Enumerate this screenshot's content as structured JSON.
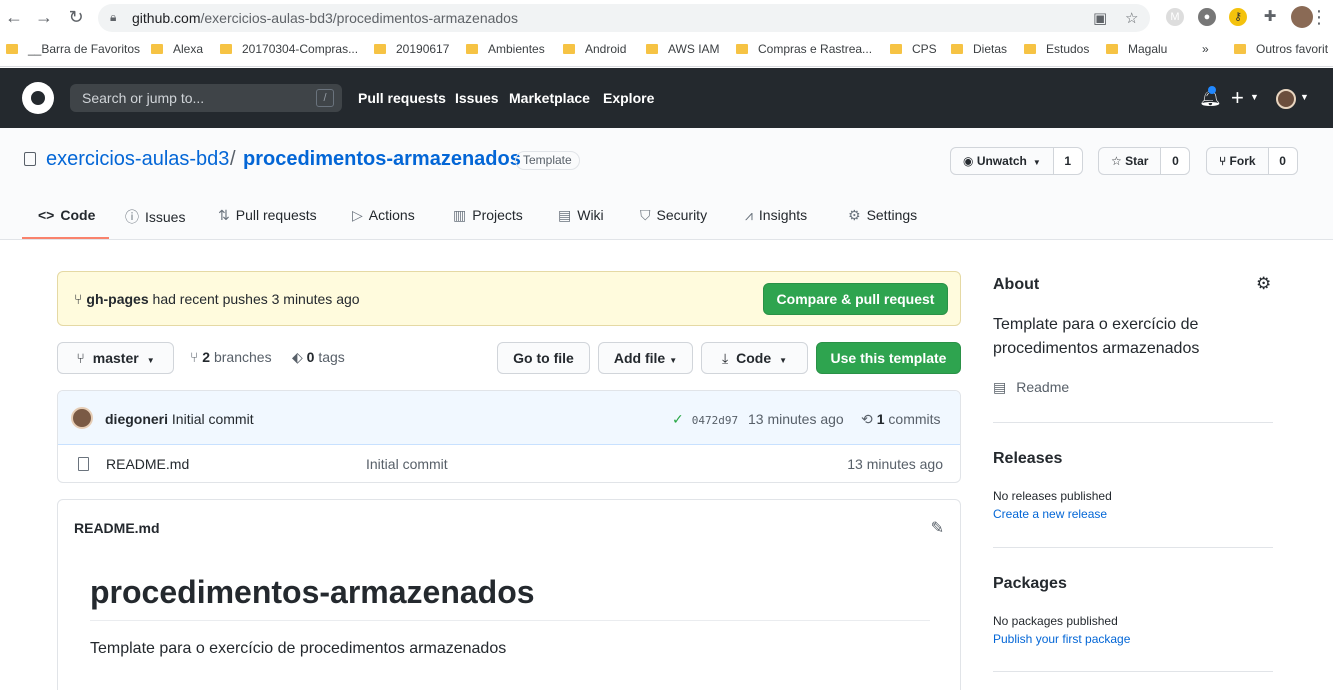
{
  "browser": {
    "url_host": "github.com",
    "url_path": "/exercicios-aulas-bd3/procedimentos-armazenados",
    "bookmarks": [
      "__Barra de Favoritos",
      "Alexa",
      "20170304-Compras...",
      "20190617",
      "Ambientes",
      "Android",
      "AWS IAM",
      "Compras e Rastrea...",
      "CPS",
      "Dietas",
      "Estudos",
      "Magalu",
      "»",
      "Outros favorit"
    ]
  },
  "header": {
    "search_placeholder": "Search or jump to...",
    "search_shortcut": "/",
    "nav": [
      "Pull requests",
      "Issues",
      "Marketplace",
      "Explore"
    ]
  },
  "repo": {
    "owner": "exercicios-aulas-bd3",
    "separator": "/",
    "name": "procedimentos-armazenados",
    "badge": "Template",
    "watch_label": "Unwatch",
    "watch_count": "1",
    "star_label": "Star",
    "star_count": "0",
    "fork_label": "Fork",
    "fork_count": "0",
    "tabs": [
      "Code",
      "Issues",
      "Pull requests",
      "Actions",
      "Projects",
      "Wiki",
      "Security",
      "Insights",
      "Settings"
    ]
  },
  "flash": {
    "branch": "gh-pages",
    "message": "had recent pushes 3 minutes ago",
    "button": "Compare & pull request"
  },
  "toolbar": {
    "branch": "master",
    "branches_count": "2",
    "branches_label": "branches",
    "tags_count": "0",
    "tags_label": "tags",
    "go_to_file": "Go to file",
    "add_file": "Add file",
    "code": "Code",
    "use_template": "Use this template"
  },
  "commit": {
    "author": "diegoneri",
    "message": "Initial commit",
    "sha": "0472d97",
    "age": "13 minutes ago",
    "commits_count": "1",
    "commits_label": "commits"
  },
  "files": [
    {
      "name": "README.md",
      "message": "Initial commit",
      "age": "13 minutes ago"
    }
  ],
  "readme": {
    "title": "README.md",
    "heading": "procedimentos-armazenados",
    "body": "Template para o exercício de procedimentos armazenados"
  },
  "sidebar": {
    "about_title": "About",
    "description": "Template para o exercício de procedimentos armazenados",
    "readme_label": "Readme",
    "releases_title": "Releases",
    "releases_empty": "No releases published",
    "releases_link": "Create a new release",
    "packages_title": "Packages",
    "packages_empty": "No packages published",
    "packages_link": "Publish your first package"
  }
}
